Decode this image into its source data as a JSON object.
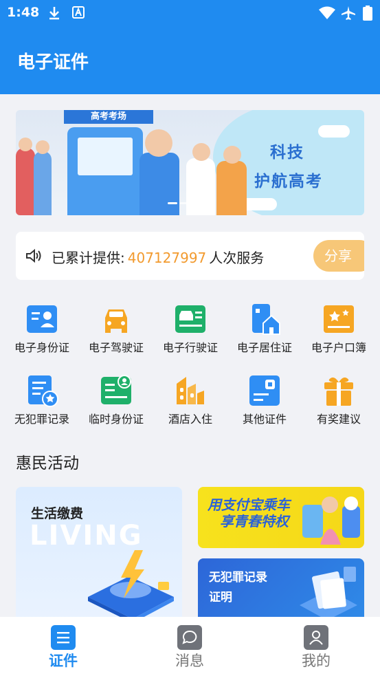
{
  "status": {
    "time": "1:48"
  },
  "header": {
    "title": "电子证件"
  },
  "banner": {
    "tag": "高考考场",
    "line1": "科技",
    "line2": "护航高考"
  },
  "notice": {
    "prefix": "已累计提供:",
    "count": "407127997",
    "suffix": "人次服务",
    "share_label": "分享"
  },
  "services": [
    {
      "label": "电子身份证",
      "icon": "id-card-icon",
      "color": "#2f8ef4"
    },
    {
      "label": "电子驾驶证",
      "icon": "car-icon",
      "color": "#f6a623"
    },
    {
      "label": "电子行驶证",
      "icon": "vehicle-license-icon",
      "color": "#1fb06a"
    },
    {
      "label": "电子居住证",
      "icon": "residence-icon",
      "color": "#2f8ef4"
    },
    {
      "label": "电子户口簿",
      "icon": "household-book-icon",
      "color": "#f6a623"
    },
    {
      "label": "无犯罪记录",
      "icon": "record-badge-icon",
      "color": "#2f8ef4"
    },
    {
      "label": "临时身份证",
      "icon": "temp-id-icon",
      "color": "#1fb06a"
    },
    {
      "label": "酒店入住",
      "icon": "hotel-icon",
      "color": "#f6a623"
    },
    {
      "label": "其他证件",
      "icon": "other-cert-icon",
      "color": "#2f8ef4"
    },
    {
      "label": "有奖建议",
      "icon": "gift-icon",
      "color": "#f6a623"
    }
  ],
  "section": {
    "title": "惠民活动"
  },
  "cards": {
    "living": {
      "title": "生活缴费",
      "bg_text": "LIVING"
    },
    "alipay": {
      "line1": "用支付宝乘车",
      "line2": "享青春特权"
    },
    "record": {
      "line1": "无犯罪记录",
      "line2": "证明"
    }
  },
  "tabs": [
    {
      "label": "证件",
      "active": true
    },
    {
      "label": "消息",
      "active": false
    },
    {
      "label": "我的",
      "active": false
    }
  ],
  "colors": {
    "primary": "#1f8bf0",
    "accent_orange": "#f29a2e",
    "tab_inactive": "#777777"
  }
}
